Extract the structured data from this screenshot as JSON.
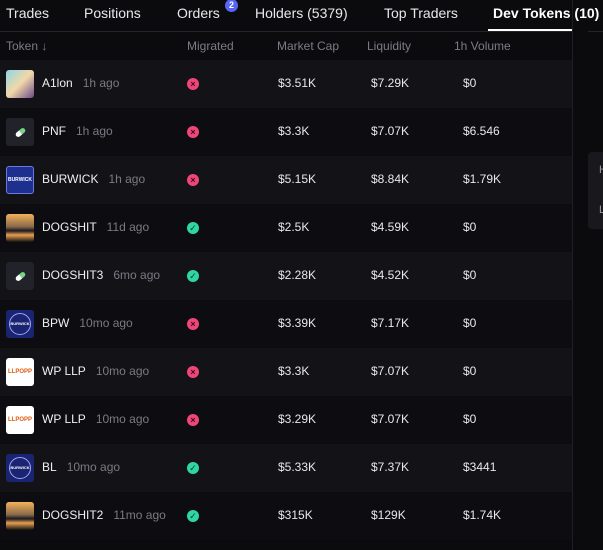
{
  "tabs": [
    {
      "label": "Trades"
    },
    {
      "label": "Positions"
    },
    {
      "label": "Orders",
      "badge": "2"
    },
    {
      "label": "Holders (5379)"
    },
    {
      "label": "Top Traders"
    },
    {
      "label": "Dev Tokens (10)"
    }
  ],
  "columns": {
    "token": "Token ↓",
    "migrated": "Migrated",
    "market_cap": "Market Cap",
    "liquidity": "Liquidity",
    "volume": "1h Volume"
  },
  "rows": [
    {
      "name": "A1lon",
      "ago": "1h ago",
      "migrated": false,
      "mcap": "$3.51K",
      "liq": "$7.29K",
      "vol": "$0",
      "avatar": "pixel"
    },
    {
      "name": "PNF",
      "ago": "1h ago",
      "migrated": false,
      "mcap": "$3.3K",
      "liq": "$7.07K",
      "vol": "$6.546",
      "avatar": "pill"
    },
    {
      "name": "BURWICK",
      "ago": "1h ago",
      "migrated": false,
      "mcap": "$5.15K",
      "liq": "$8.84K",
      "vol": "$1.79K",
      "avatar": "burwick",
      "avatar_text": "BURWICK"
    },
    {
      "name": "DOGSHIT",
      "ago": "11d ago",
      "migrated": true,
      "mcap": "$2.5K",
      "liq": "$4.59K",
      "vol": "$0",
      "avatar": "sunset"
    },
    {
      "name": "DOGSHIT3",
      "ago": "6mo ago",
      "migrated": true,
      "mcap": "$2.28K",
      "liq": "$4.52K",
      "vol": "$0",
      "avatar": "pill"
    },
    {
      "name": "BPW",
      "ago": "10mo ago",
      "migrated": false,
      "mcap": "$3.39K",
      "liq": "$7.17K",
      "vol": "$0",
      "avatar": "circle",
      "avatar_text": "BURWICK"
    },
    {
      "name": "WP LLP",
      "ago": "10mo ago",
      "migrated": false,
      "mcap": "$3.3K",
      "liq": "$7.07K",
      "vol": "$0",
      "avatar": "wp",
      "avatar_text": "LLPOPP"
    },
    {
      "name": "WP LLP",
      "ago": "10mo ago",
      "migrated": false,
      "mcap": "$3.29K",
      "liq": "$7.07K",
      "vol": "$0",
      "avatar": "wp",
      "avatar_text": "LLPOPP"
    },
    {
      "name": "BL",
      "ago": "10mo ago",
      "migrated": true,
      "mcap": "$5.33K",
      "liq": "$7.37K",
      "vol": "$3441",
      "avatar": "circle",
      "avatar_text": "BURWICK"
    },
    {
      "name": "DOGSHIT2",
      "ago": "11mo ago",
      "migrated": true,
      "mcap": "$315K",
      "liq": "$129K",
      "vol": "$1.74K",
      "avatar": "sunset"
    }
  ],
  "side_panel": {
    "line1": "H",
    "line2": "L"
  },
  "colors": {
    "accent": "#5865f2",
    "not_migrated": "#f0457a",
    "migrated": "#2fd6a0"
  }
}
